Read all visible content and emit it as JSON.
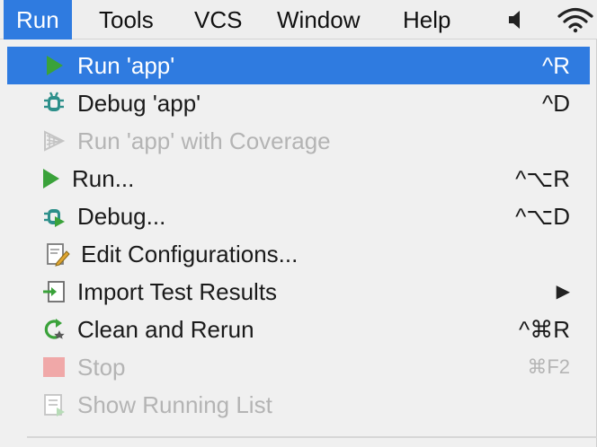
{
  "menubar": {
    "items": [
      {
        "label": "Run",
        "active": true
      },
      {
        "label": "Tools"
      },
      {
        "label": "VCS"
      },
      {
        "label": "Window"
      },
      {
        "label": "Help"
      }
    ],
    "status_icons": [
      "volume-icon",
      "wifi-icon"
    ]
  },
  "menu": {
    "items": [
      {
        "label": "Run 'app'",
        "shortcut": "^R",
        "icon": "run-icon",
        "highlighted": true
      },
      {
        "label": "Debug 'app'",
        "shortcut": "^D",
        "icon": "debug-icon"
      },
      {
        "label": "Run 'app' with Coverage",
        "shortcut": "",
        "icon": "coverage-icon",
        "disabled": true
      },
      {
        "label": "Run...",
        "shortcut": "^⌥R",
        "icon": "run-icon"
      },
      {
        "label": "Debug...",
        "shortcut": "^⌥D",
        "icon": "debug-icon"
      },
      {
        "label": "Edit Configurations...",
        "shortcut": "",
        "icon": "edit-configurations-icon"
      },
      {
        "label": "Import Test Results",
        "shortcut": "▶",
        "icon": "import-icon"
      },
      {
        "label": "Clean and Rerun",
        "shortcut": "^⌘R",
        "icon": "rerun-icon"
      },
      {
        "label": "Stop",
        "shortcut": "⌘F2",
        "icon": "stop-icon",
        "disabled": true
      },
      {
        "label": "Show Running List",
        "shortcut": "",
        "icon": "running-list-icon",
        "disabled": true
      }
    ]
  },
  "colors": {
    "highlight": "#2f7be0",
    "run_green": "#3aa23a",
    "debug_teal": "#2c8f8a",
    "disabled_text": "#b4b4b4"
  }
}
